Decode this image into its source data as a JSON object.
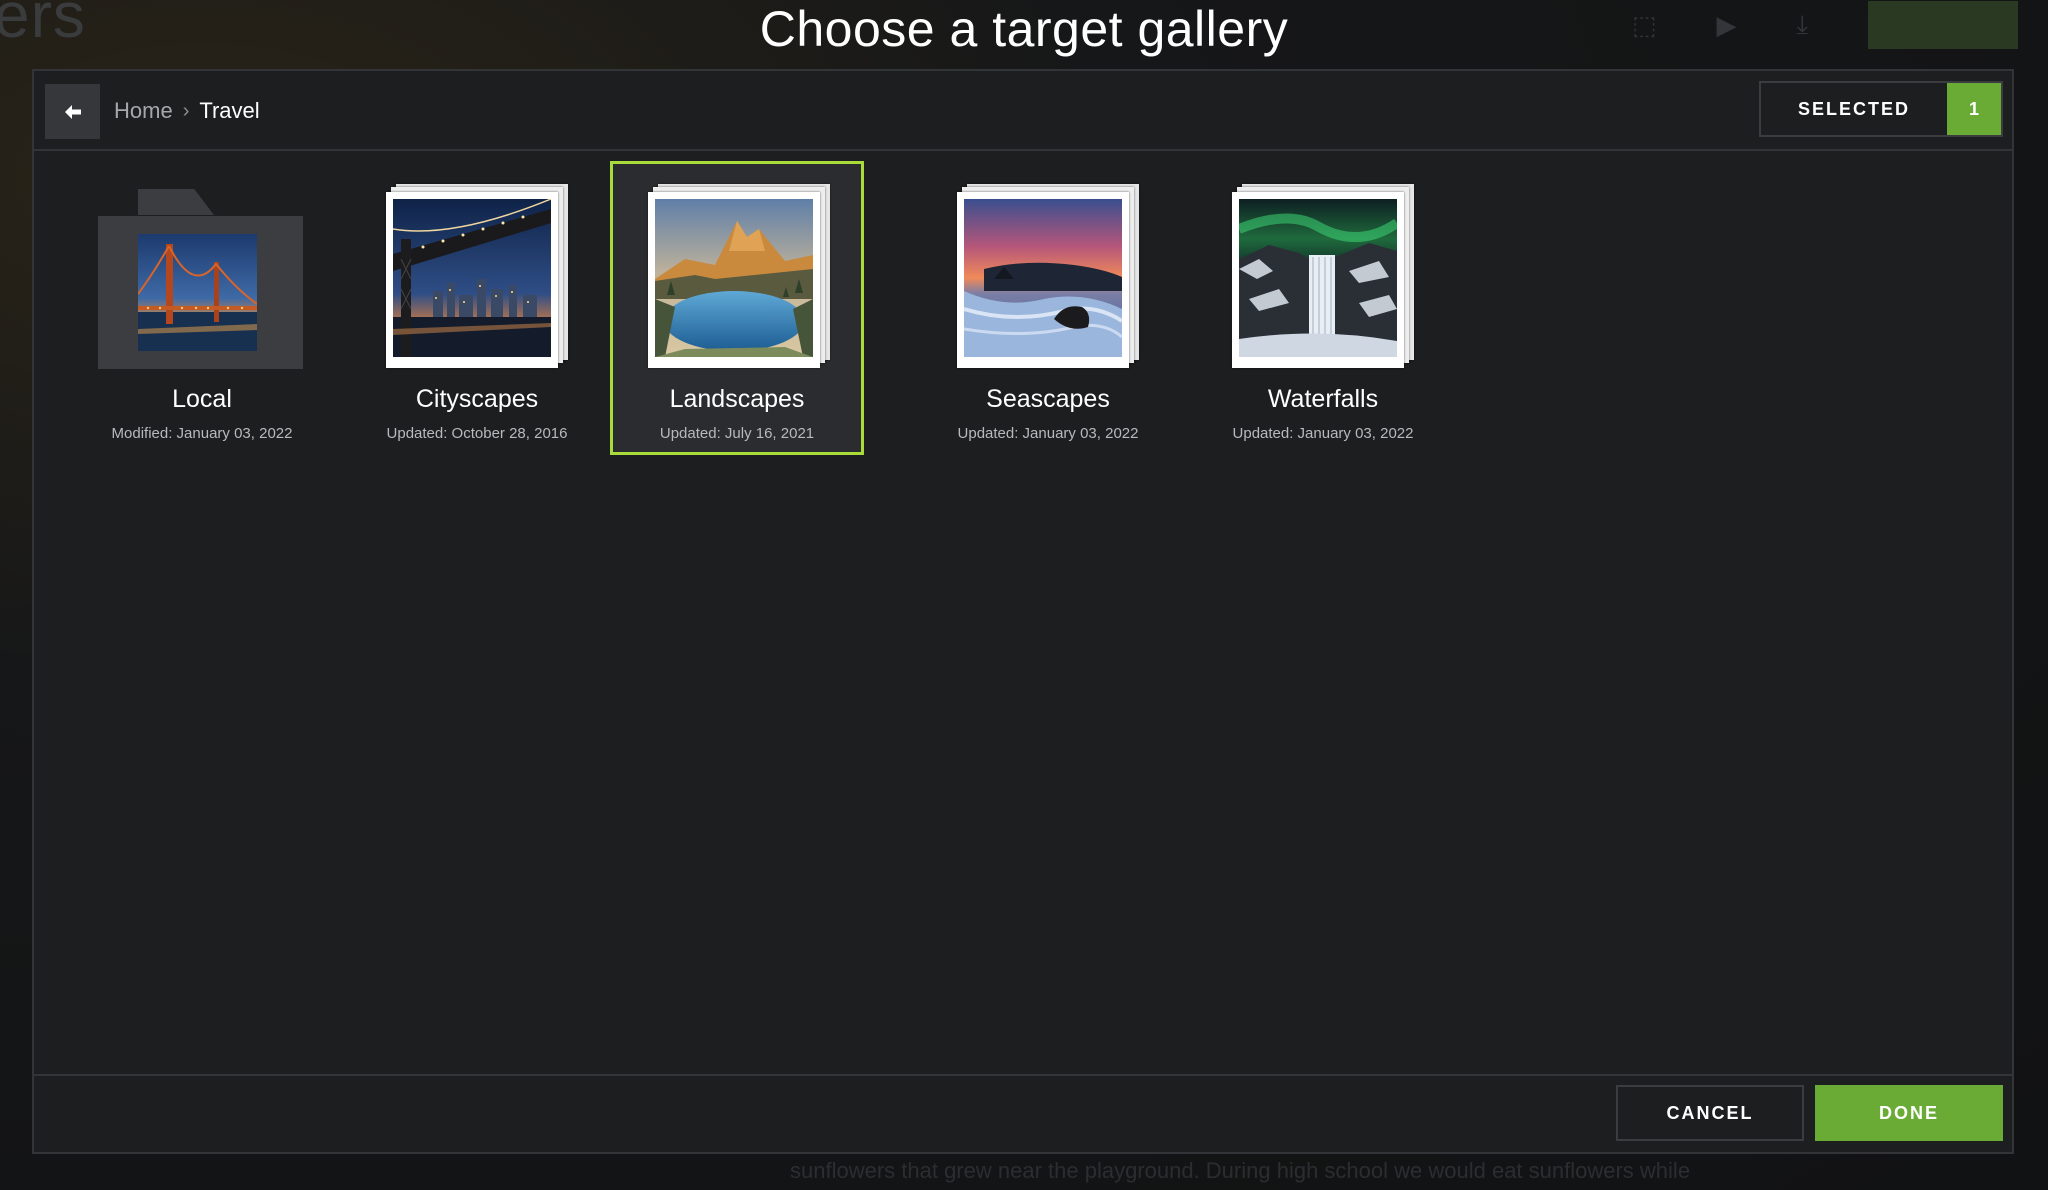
{
  "page": {
    "title": "Choose a target gallery",
    "background_text": "ers",
    "background_caption": "sunflowers that grew near the playground. During high school we would eat sunflowers while"
  },
  "header": {
    "breadcrumb": [
      "Home",
      "Travel"
    ],
    "selected_label": "SELECTED",
    "selected_count": "1"
  },
  "galleries": [
    {
      "name": "Local",
      "meta": "Modified: January 03, 2022",
      "kind": "folder",
      "selected": false,
      "icon": "bridge-photo"
    },
    {
      "name": "Cityscapes",
      "meta": "Updated: October 28, 2016",
      "kind": "gallery",
      "selected": false,
      "icon": "city-bridge-photo"
    },
    {
      "name": "Landscapes",
      "meta": "Updated: July 16, 2021",
      "kind": "gallery",
      "selected": true,
      "icon": "mountain-lake-photo"
    },
    {
      "name": "Seascapes",
      "meta": "Updated: January 03, 2022",
      "kind": "gallery",
      "selected": false,
      "icon": "seascape-photo"
    },
    {
      "name": "Waterfalls",
      "meta": "Updated: January 03, 2022",
      "kind": "gallery",
      "selected": false,
      "icon": "waterfall-aurora-photo"
    }
  ],
  "footer": {
    "cancel_label": "CANCEL",
    "done_label": "DONE"
  },
  "colors": {
    "accent": "#6aab35",
    "selection_border": "#a9dc3a",
    "dialog_bg": "#1d1e20"
  }
}
